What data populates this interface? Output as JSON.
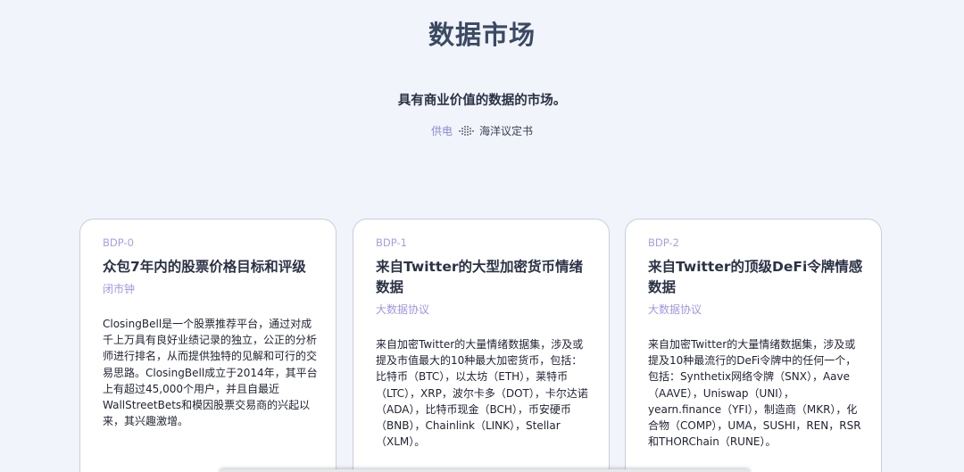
{
  "header": {
    "title": "数据市场",
    "subtitle": "具有商业价值的数据的市场。",
    "powered_by": "供电",
    "brand": "海洋议定书",
    "brand_icon": "ocean-protocol-logo-icon"
  },
  "cards": [
    {
      "code": "BDP-0",
      "title": "众包7年内的股票价格目标和评级",
      "publisher": "闭市钟",
      "description": "ClosingBell是一个股票推荐平台，通过对成千上万具有良好业绩记录的独立，公正的分析师进行排名，从而提供独特的见解和可行的交易思路。ClosingBell成立于2014年，其平台上有超过45,000个用户，并且自最近WallStreetBets和模因股票交易商的兴起以来，其兴趣激增。"
    },
    {
      "code": "BDP-1",
      "title": "来自Twitter的大型加密货币情绪数据",
      "publisher": "大数据协议",
      "description": "来自加密Twitter的大量情绪数据集，涉及或提及市值最大的10种最大加密货币，包括：比特币（BTC），以太坊（ETH），莱特币（LTC），XRP，波尔卡多（DOT），卡尔达诺（ADA），比特币现金（BCH），币安硬币（BNB），Chainlink（LINK），Stellar（XLM）。"
    },
    {
      "code": "BDP-2",
      "title": "来自Twitter的顶级DeFi令牌情感数据",
      "publisher": "大数据协议",
      "description": "来自加密Twitter的大量情绪数据集，涉及或提及10种最流行的DeFi令牌中的任何一个，包括：Synthetix网络令牌（SNX），Aave（AAVE），Uniswap（UNI），yearn.finance（YFI），制造商（MKR），化合物（COMP），UMA，SUSHI，REN，RSR和THORChain（RUNE）。"
    }
  ],
  "colors": {
    "background": "#f1f4fa",
    "accent": "#9e97e2",
    "title": "#3b4a63"
  }
}
